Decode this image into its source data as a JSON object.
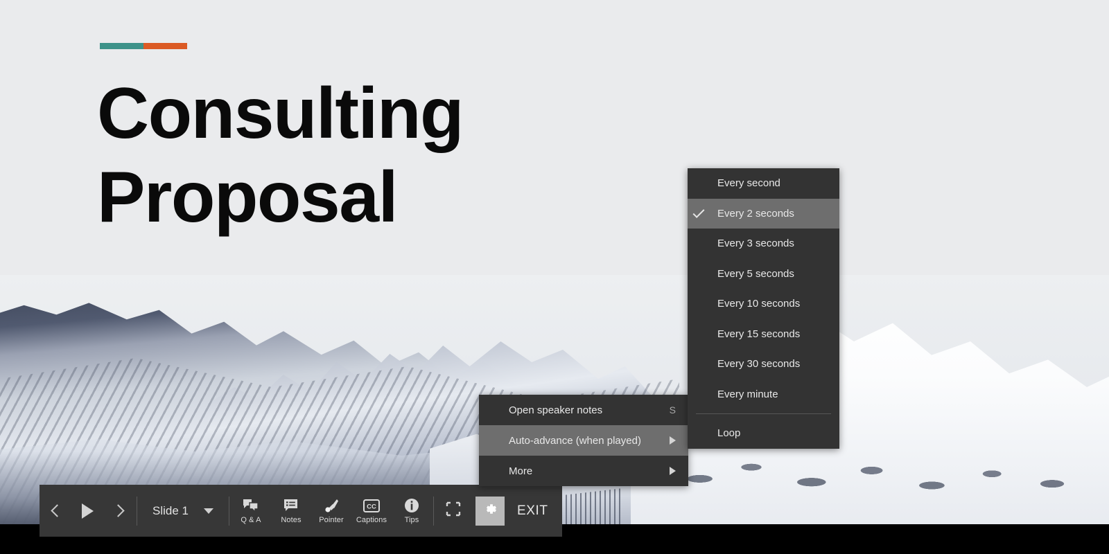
{
  "slide": {
    "accent_bar": {
      "left_color": "#3d9289",
      "right_color": "#db5a24"
    },
    "title_line1": "Consulting",
    "title_line2": "Proposal",
    "background_color": "#eaebed",
    "image_alt": "snow-covered-mountain-range"
  },
  "toolbar": {
    "previous_label": "previous-slide",
    "play_label": "play",
    "next_label": "next-slide",
    "slide_selector": {
      "label": "Slide 1",
      "caret": "chevron-down-icon"
    },
    "tools": [
      {
        "icon": "qa-bubbles-icon",
        "label": "Q & A"
      },
      {
        "icon": "notes-bubble-icon",
        "label": "Notes"
      },
      {
        "icon": "laser-pointer-icon",
        "label": "Pointer"
      },
      {
        "icon": "closed-captions-icon",
        "label": "Captions"
      },
      {
        "icon": "info-circle-icon",
        "label": "Tips"
      }
    ],
    "fit_icon": "exit-fullscreen-icon",
    "options_icon": "gear-icon",
    "exit_label": "EXIT",
    "background_color": "#373737"
  },
  "context_menu": {
    "background_color": "#333333",
    "highlight_color": "#6e6e6e",
    "items": [
      {
        "label": "Open speaker notes",
        "shortcut": "S",
        "submenu": false,
        "highlighted": false
      },
      {
        "label": "Auto-advance (when played)",
        "shortcut": "",
        "submenu": true,
        "highlighted": true
      },
      {
        "label": "More",
        "shortcut": "",
        "submenu": true,
        "highlighted": false
      }
    ]
  },
  "submenu": {
    "background_color": "#333333",
    "highlight_color": "#6e6e6e",
    "items": [
      {
        "label": "Every second",
        "checked": false,
        "highlighted": false
      },
      {
        "label": "Every 2 seconds",
        "checked": true,
        "highlighted": true
      },
      {
        "label": "Every 3 seconds",
        "checked": false,
        "highlighted": false
      },
      {
        "label": "Every 5 seconds",
        "checked": false,
        "highlighted": false
      },
      {
        "label": "Every 10 seconds",
        "checked": false,
        "highlighted": false
      },
      {
        "label": "Every 15 seconds",
        "checked": false,
        "highlighted": false
      },
      {
        "label": "Every 30 seconds",
        "checked": false,
        "highlighted": false
      },
      {
        "label": "Every minute",
        "checked": false,
        "highlighted": false
      }
    ],
    "loop_label": "Loop"
  }
}
